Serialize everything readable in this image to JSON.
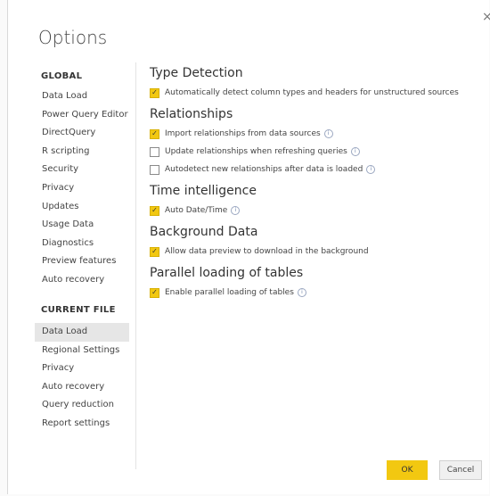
{
  "dialog": {
    "title": "Options",
    "close_glyph": "×",
    "ok_label": "OK",
    "cancel_label": "Cancel"
  },
  "nav": {
    "global_header": "GLOBAL",
    "global_items": [
      "Data Load",
      "Power Query Editor",
      "DirectQuery",
      "R scripting",
      "Security",
      "Privacy",
      "Updates",
      "Usage Data",
      "Diagnostics",
      "Preview features",
      "Auto recovery"
    ],
    "current_header": "CURRENT FILE",
    "current_items": [
      "Data Load",
      "Regional Settings",
      "Privacy",
      "Auto recovery",
      "Query reduction",
      "Report settings"
    ],
    "selected_item": "Data Load (CURRENT FILE)"
  },
  "sections": {
    "type_detection": {
      "title": "Type Detection",
      "options": [
        {
          "label": "Automatically detect column types and headers for unstructured sources",
          "checked": true,
          "info": false
        }
      ]
    },
    "relationships": {
      "title": "Relationships",
      "options": [
        {
          "label": "Import relationships from data sources",
          "checked": true,
          "info": true
        },
        {
          "label": "Update relationships when refreshing queries",
          "checked": false,
          "info": true
        },
        {
          "label": "Autodetect new relationships after data is loaded",
          "checked": false,
          "info": true
        }
      ]
    },
    "time_intelligence": {
      "title": "Time intelligence",
      "options": [
        {
          "label": "Auto Date/Time",
          "checked": true,
          "info": true
        }
      ]
    },
    "background_data": {
      "title": "Background Data",
      "options": [
        {
          "label": "Allow data preview to download in the background",
          "checked": true,
          "info": false
        }
      ]
    },
    "parallel_loading": {
      "title": "Parallel loading of tables",
      "options": [
        {
          "label": "Enable parallel loading of tables",
          "checked": true,
          "info": true
        }
      ]
    }
  },
  "icons": {
    "check_glyph": "✓",
    "info_glyph": "i"
  },
  "colors": {
    "accent": "#f2c811"
  }
}
